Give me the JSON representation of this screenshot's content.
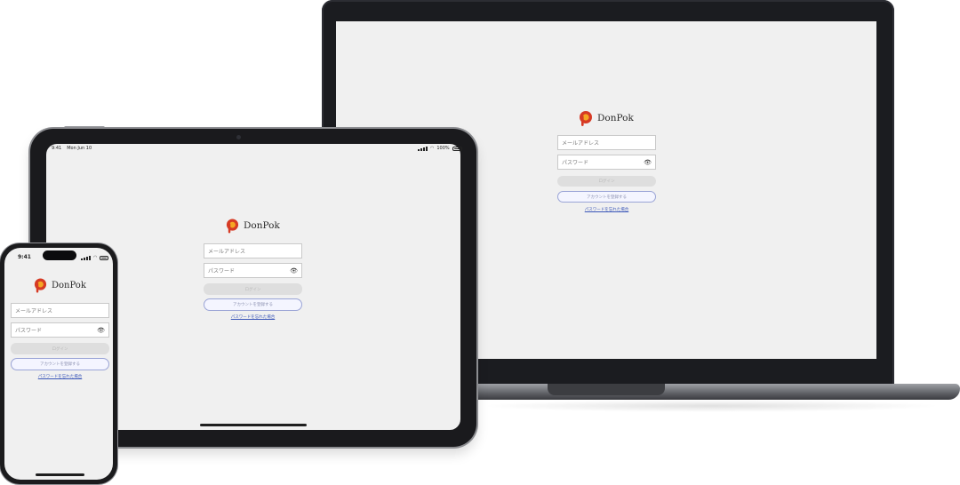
{
  "app": {
    "brand": "DonPok",
    "email_placeholder": "メールアドレス",
    "password_placeholder": "パスワード",
    "login_button": "ログイン",
    "create_account_button": "アカウントを登録する",
    "forgot_password_link": "パスワードを忘れた場合",
    "eye_icon": "👁",
    "brand_colors": {
      "outer": "#d63a24",
      "inner": "#f5a623"
    }
  },
  "tablet_status": {
    "time": "9:41",
    "date": "Mon Jun 10",
    "battery": "100%"
  },
  "phone_status": {
    "time": "9:41"
  }
}
